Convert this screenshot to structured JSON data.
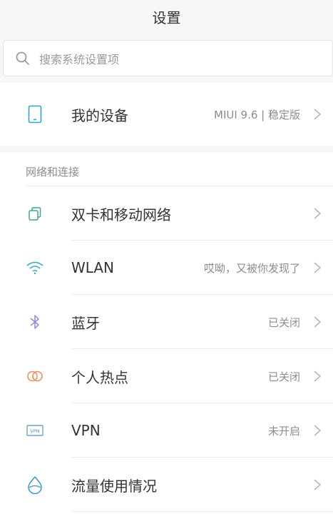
{
  "header": {
    "title": "设置"
  },
  "search": {
    "placeholder": "搜索系统设置项"
  },
  "device": {
    "label": "我的设备",
    "value": "MIUI 9.6 | 稳定版"
  },
  "network": {
    "section_title": "网络和连接",
    "items": [
      {
        "label": "双卡和移动网络",
        "value": "",
        "icon": "sim-cards-icon",
        "color": "#3fa58d"
      },
      {
        "label": "WLAN",
        "value": "哎呦，又被你发现了",
        "icon": "wifi-icon",
        "color": "#3aa3d4"
      },
      {
        "label": "蓝牙",
        "value": "已关闭",
        "icon": "bluetooth-icon",
        "color": "#9a86d8"
      },
      {
        "label": "个人热点",
        "value": "已关闭",
        "icon": "hotspot-icon",
        "color": "#ef8a52"
      },
      {
        "label": "VPN",
        "value": "未开启",
        "icon": "vpn-icon",
        "color": "#5b8ec4"
      },
      {
        "label": "流量使用情况",
        "value": "",
        "icon": "data-usage-icon",
        "color": "#3a98c8"
      }
    ]
  },
  "colors": {
    "background": "#f7f7f7",
    "card": "#ffffff",
    "accent": "#2fa3c8"
  }
}
